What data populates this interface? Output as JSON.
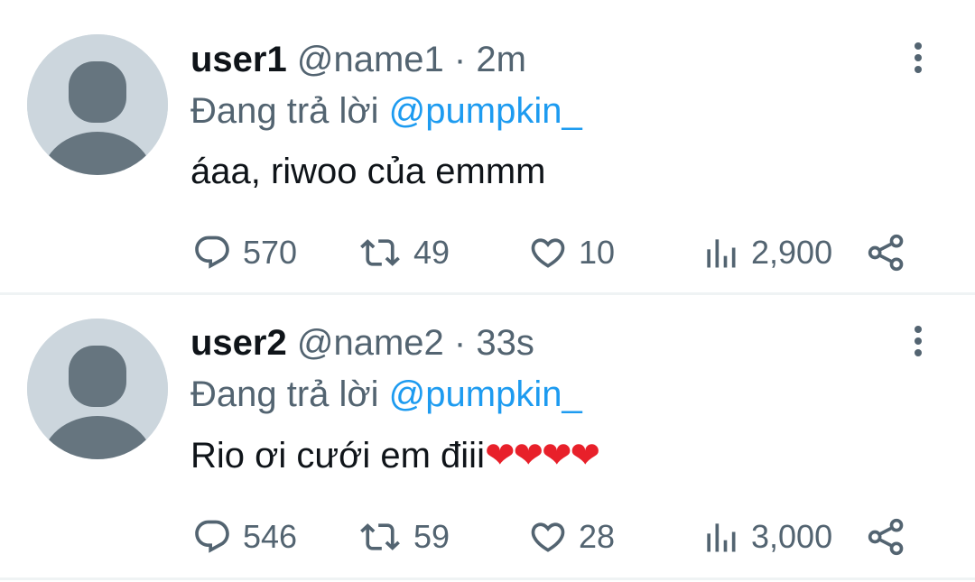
{
  "tweets": [
    {
      "display_name": "user1",
      "handle": "@name1",
      "separator": "·",
      "time": "2m",
      "reply_prefix": "Đang trả lời",
      "reply_to": "@pumpkin_",
      "text": "áaa, riwoo của emmm",
      "text_emoji": "",
      "replies": "570",
      "retweets": "49",
      "likes": "10",
      "views": "2,900",
      "avatar_icon": "default-avatar-icon",
      "avatar_color": "#ccd6dd"
    },
    {
      "display_name": "user2",
      "handle": "@name2",
      "separator": "·",
      "time": "33s",
      "reply_prefix": "Đang trả lời",
      "reply_to": "@pumpkin_",
      "text": "Rio ơi cưới em điii",
      "text_emoji": "❤❤❤❤",
      "replies": "546",
      "retweets": "59",
      "likes": "28",
      "views": "3,000",
      "avatar_icon": "default-avatar-icon",
      "avatar_color": "#ccd6dd"
    }
  ],
  "colors": {
    "text_primary": "#0f1419",
    "text_secondary": "#536471",
    "accent": "#1d9bf0",
    "heart": "#e8202a",
    "divider": "#eff3f4"
  },
  "icons": {
    "reply": "reply-icon",
    "retweet": "retweet-icon",
    "like": "heart-icon",
    "views": "views-icon",
    "share": "share-icon",
    "more": "more-options-icon"
  }
}
